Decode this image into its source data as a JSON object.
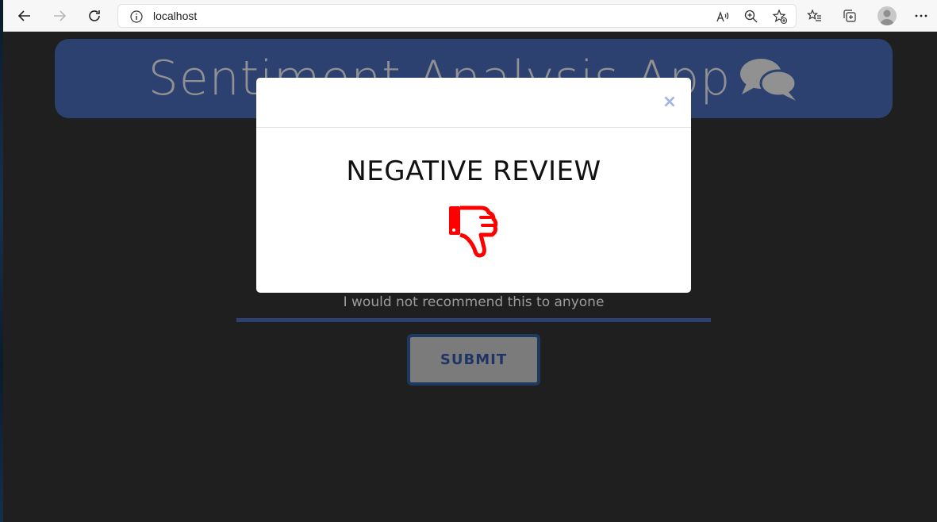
{
  "browser": {
    "url": "localhost",
    "icons": [
      "back-icon",
      "forward-icon",
      "refresh-icon",
      "info-icon",
      "read-aloud-icon",
      "zoom-icon",
      "add-favorite-icon",
      "favorites-icon",
      "collections-icon",
      "profile-icon",
      "more-icon"
    ]
  },
  "app": {
    "title": "Sentiment Analysis App",
    "title_icon": "chat-bubbles-icon",
    "review_text": "I would not recommend this to anyone",
    "submit_label": "SUBMIT"
  },
  "modal": {
    "close_label": "×",
    "result_title": "NEGATIVE REVIEW",
    "result_icon": "thumbs-down-icon"
  },
  "colors": {
    "accent": "#3d5b9b",
    "page_background": "#2b2b2b",
    "negative": "#ff0000",
    "close_x": "#9fb5e6"
  }
}
